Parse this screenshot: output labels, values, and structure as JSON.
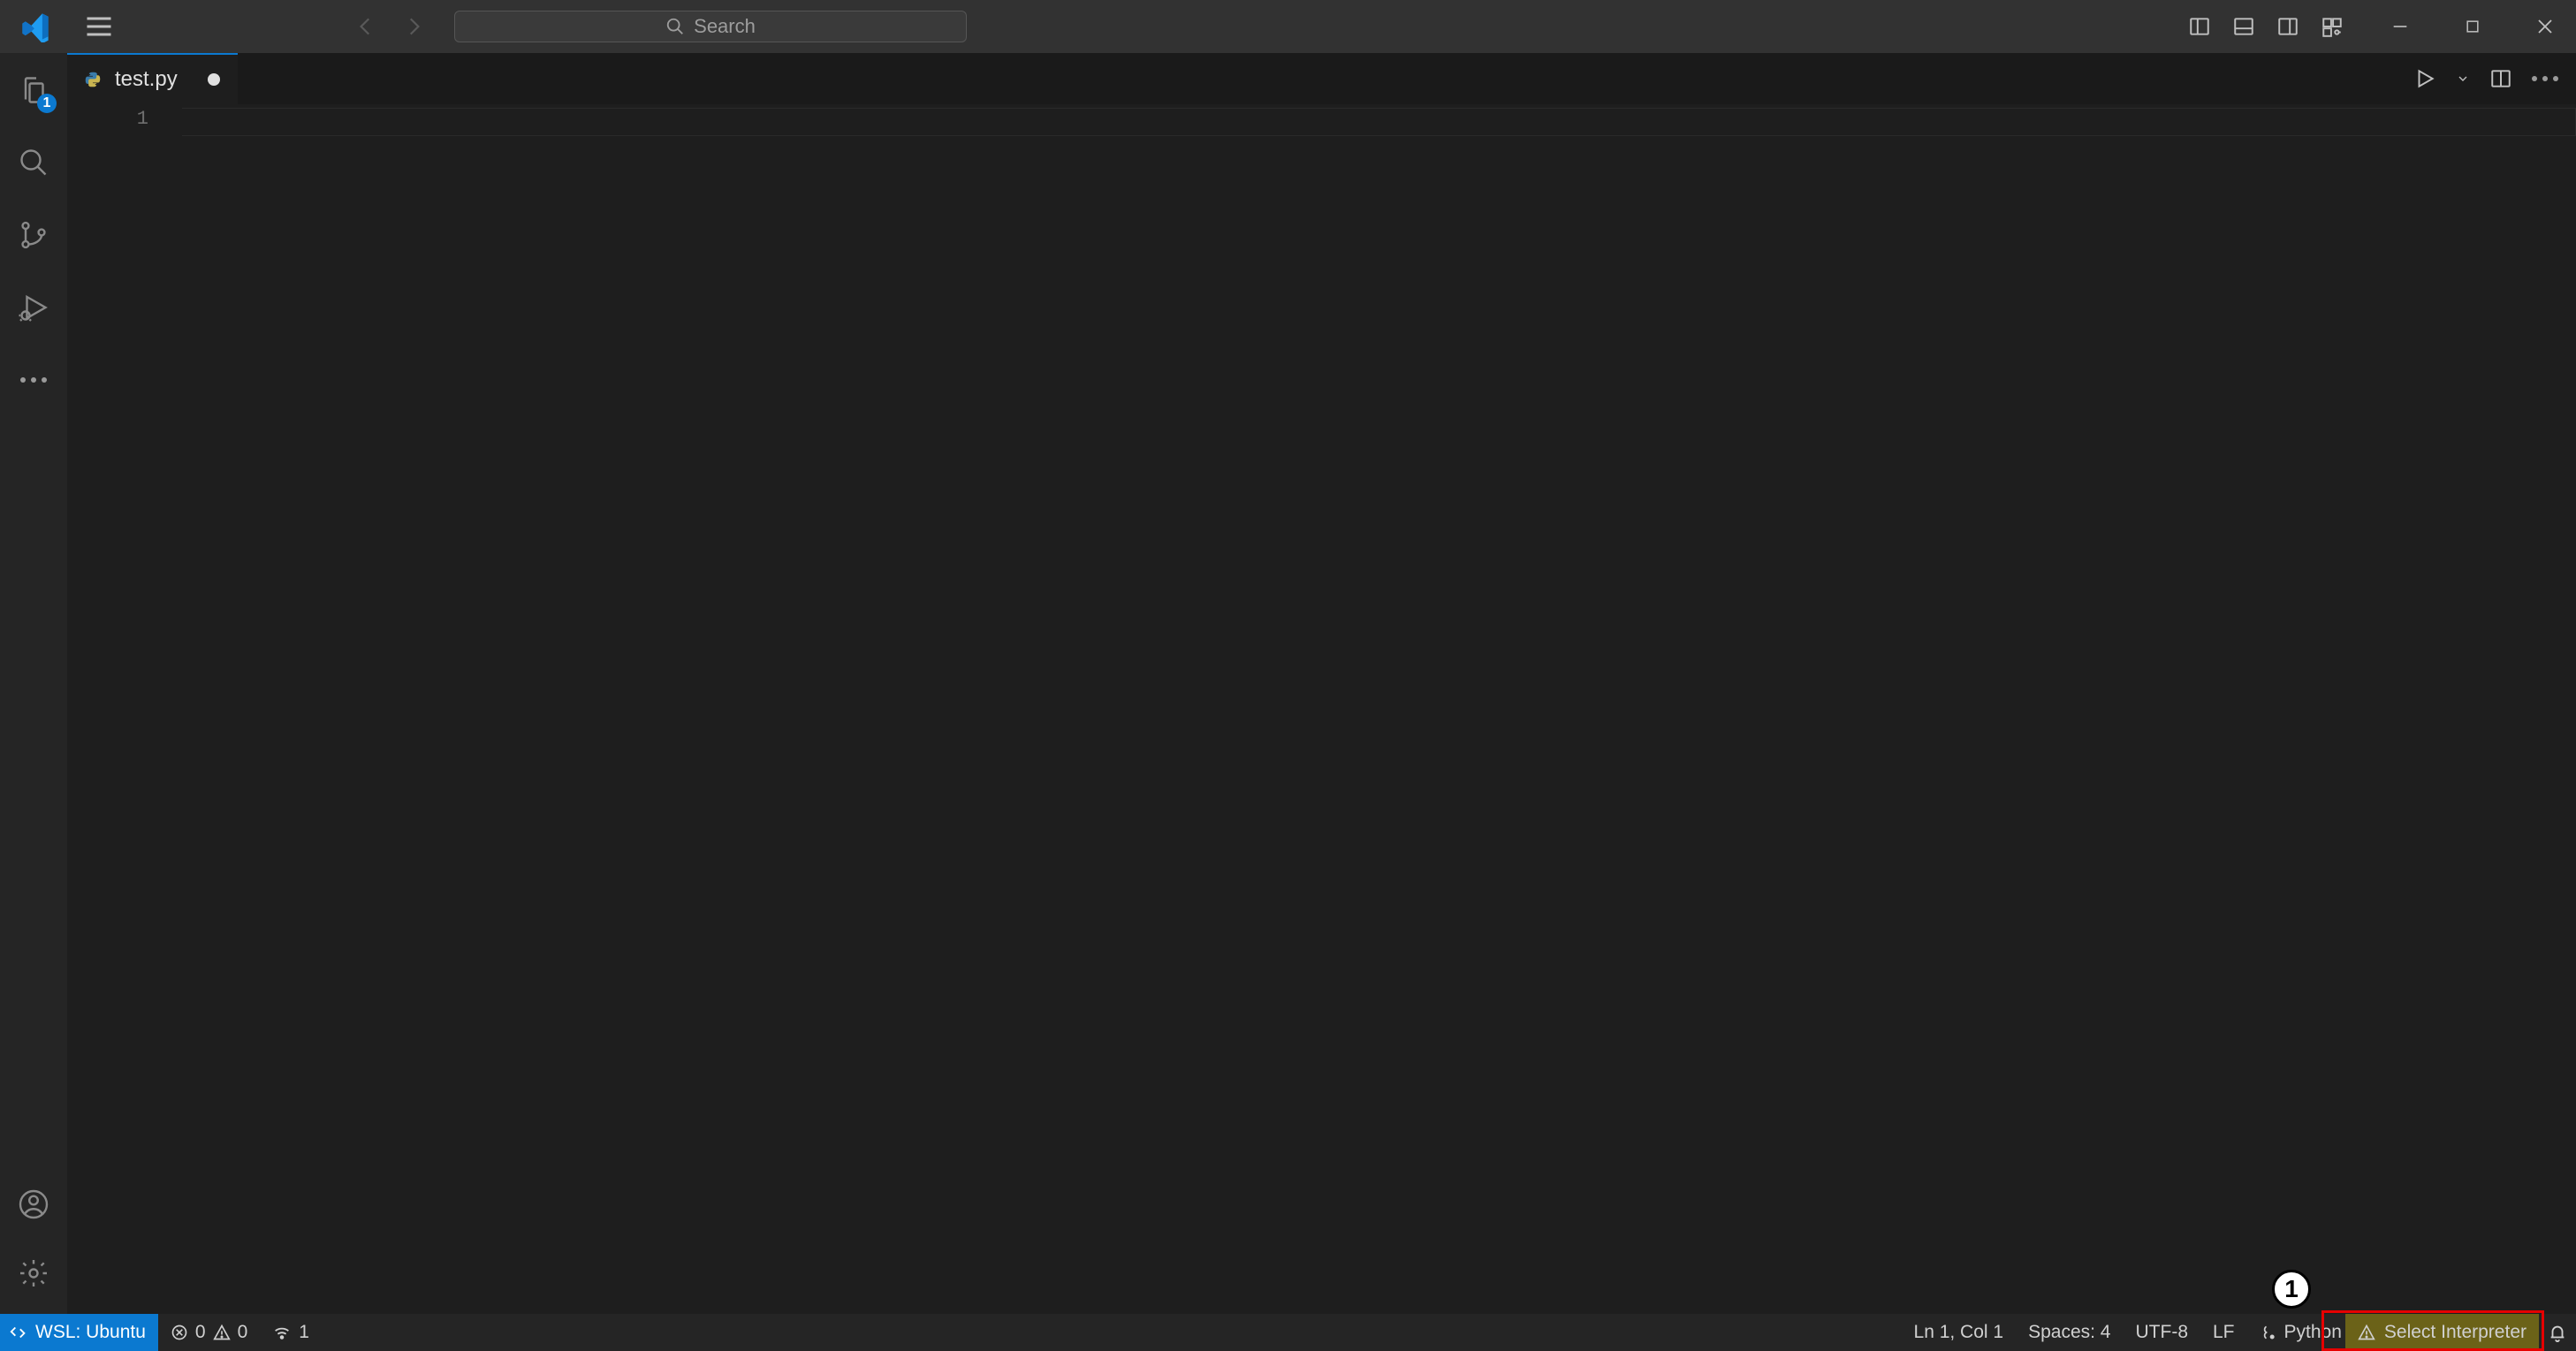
{
  "titlebar": {
    "search_placeholder": "Search"
  },
  "activity": {
    "explorer_badge": "1"
  },
  "tab": {
    "filename": "test.py"
  },
  "editor": {
    "line_number": "1"
  },
  "status": {
    "remote_label": "WSL: Ubuntu",
    "errors": "0",
    "warnings": "0",
    "ports": "1",
    "cursor": "Ln 1, Col 1",
    "indent": "Spaces: 4",
    "encoding": "UTF-8",
    "eol": "LF",
    "language": "Python",
    "interpreter_warning": "Select Interpreter"
  },
  "annotation": {
    "callout": "1"
  }
}
